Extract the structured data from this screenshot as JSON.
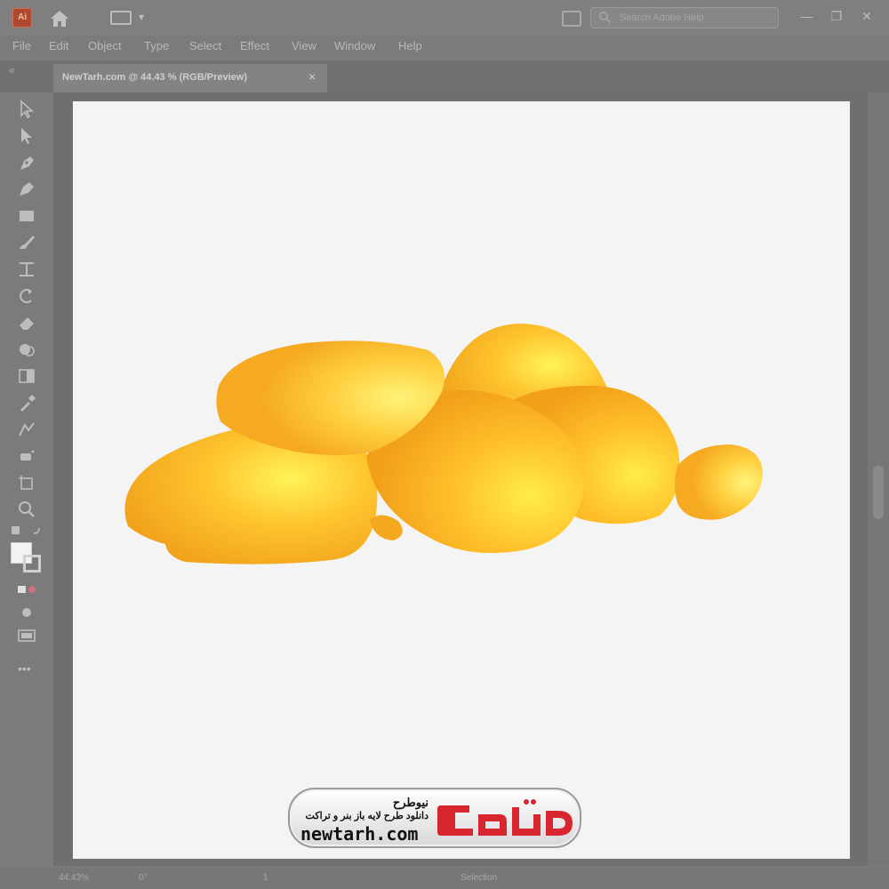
{
  "app": {
    "logo_text": "Ai",
    "search_placeholder": "Search Adobe Help"
  },
  "menu": [
    "File",
    "Edit",
    "Object",
    "Type",
    "Select",
    "Effect",
    "View",
    "Window",
    "Help"
  ],
  "document_tab": {
    "label": "NewTarh.com @ 44.43 % (RGB/Preview)",
    "close_glyph": "×"
  },
  "window_controls": {
    "minimize": "—",
    "restore": "❐",
    "close": "✕"
  },
  "statusbar": {
    "zoom": "44.43%",
    "rotation": "0°",
    "artboard": "1",
    "mode": "Selection"
  },
  "artwork": {
    "subject": "yellow corn kernels",
    "colors": {
      "kernel_base": "#f5a623",
      "kernel_light": "#ffe14a",
      "kernel_dark": "#e08a10"
    }
  },
  "watermark": {
    "title": "نیوطرح",
    "subtitle": "دانلود طرح لایه باز بنر و تراکت",
    "url": "newtarh.com",
    "logo_text": "نیوطرح",
    "logo_color": "#d7262f"
  },
  "colors": {
    "chrome_bg": "#7b7b7b",
    "artboard_bg": "#f4f4f4",
    "workspace_bg": "#6f6f6f"
  }
}
